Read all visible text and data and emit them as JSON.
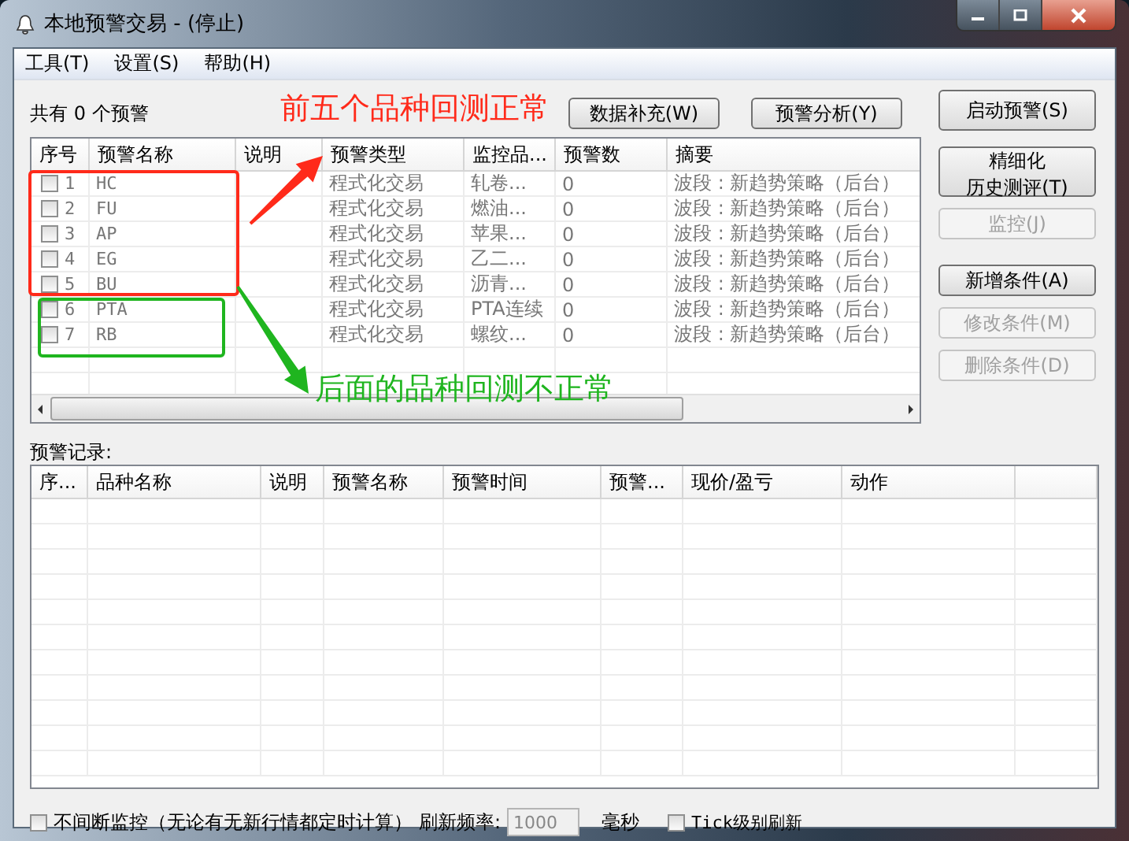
{
  "window": {
    "title": "本地预警交易 - (停止)"
  },
  "menu": [
    "工具(T)",
    "设置(S)",
    "帮助(H)"
  ],
  "alert_count": "共有 0 个预警",
  "top_buttons": [
    "数据补充(W)",
    "预警分析(Y)"
  ],
  "alerts_table": {
    "columns": [
      "序号",
      "预警名称",
      "说明",
      "预警类型",
      "监控品...",
      "预警数",
      "摘要"
    ],
    "rows": [
      {
        "checked": false,
        "index": "1",
        "name": "HC",
        "type": "程式化交易",
        "monitor": "轧卷...",
        "count": "0",
        "summary": "波段 : 新趋势策略（后台）"
      },
      {
        "checked": false,
        "index": "2",
        "name": "FU",
        "type": "程式化交易",
        "monitor": "燃油...",
        "count": "0",
        "summary": "波段 : 新趋势策略（后台）"
      },
      {
        "checked": false,
        "index": "3",
        "name": "AP",
        "type": "程式化交易",
        "monitor": "苹果...",
        "count": "0",
        "summary": "波段 : 新趋势策略（后台）"
      },
      {
        "checked": false,
        "index": "4",
        "name": "EG",
        "type": "程式化交易",
        "monitor": "乙二...",
        "count": "0",
        "summary": "波段 : 新趋势策略（后台）"
      },
      {
        "checked": false,
        "index": "5",
        "name": "BU",
        "type": "程式化交易",
        "monitor": "沥青...",
        "count": "0",
        "summary": "波段 : 新趋势策略（后台）"
      },
      {
        "checked": false,
        "index": "6",
        "name": "PTA",
        "type": "程式化交易",
        "monitor": "PTA连续",
        "count": "0",
        "summary": "波段 : 新趋势策略（后台）"
      },
      {
        "checked": false,
        "index": "7",
        "name": "RB",
        "type": "程式化交易",
        "monitor": "螺纹...",
        "count": "0",
        "summary": "波段 : 新趋势策略（后台）"
      }
    ]
  },
  "side_buttons": [
    {
      "lines": [
        "启动预警(S)"
      ],
      "disabled": false
    },
    {
      "lines": [
        "精细化",
        "历史测评(T)"
      ],
      "disabled": false
    },
    {
      "lines": [
        "监控(J)"
      ],
      "disabled": true
    },
    {
      "lines": [
        "新增条件(A)"
      ],
      "disabled": false
    },
    {
      "lines": [
        "修改条件(M)"
      ],
      "disabled": true
    },
    {
      "lines": [
        "删除条件(D)"
      ],
      "disabled": true
    }
  ],
  "records": {
    "label": "预警记录:",
    "columns": [
      "序...",
      "品种名称",
      "说明",
      "预警名称",
      "预警时间",
      "预警...",
      "现价/盈亏",
      "动作"
    ]
  },
  "footer": {
    "continuous": {
      "label": "不间断监控（无论有无新行情都定时计算）",
      "checked": false
    },
    "refresh_label": "刷新频率:",
    "refresh_value": "1000",
    "unit": "毫秒",
    "tick": {
      "label": "Tick级别刷新",
      "checked": false
    }
  },
  "annotations": [
    {
      "text": "前五个品种回测正常",
      "color": "#ff2a1a"
    },
    {
      "text": "后面的品种回测不正常",
      "color": "#1fb51f"
    }
  ]
}
